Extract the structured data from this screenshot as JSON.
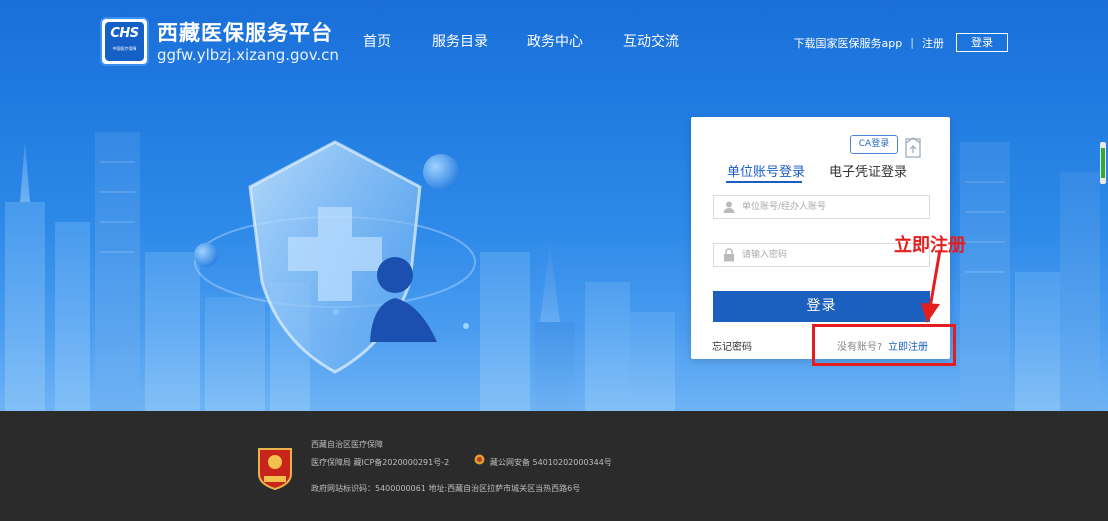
{
  "header": {
    "logo_text": "CHS",
    "logo_subtext": "中国医疗保障",
    "title": "西藏医保服务平台",
    "url": "ggfw.ylbzj.xizang.gov.cn",
    "nav": [
      "首页",
      "服务目录",
      "政务中心",
      "互动交流"
    ],
    "download_app": "下载国家医保服务app",
    "separator": "|",
    "register": "注册",
    "login": "登录"
  },
  "login_card": {
    "ca_login": "CA登录",
    "tabs": [
      "单位账号登录",
      "电子凭证登录"
    ],
    "account_placeholder": "单位账号/经办人账号",
    "password_placeholder": "请输入密码",
    "login_button": "登录",
    "forgot_password": "忘记密码",
    "no_account": "没有账号?",
    "register_now": "立即注册"
  },
  "annotation": {
    "label": "立即注册",
    "color": "#e41e1e"
  },
  "footer": {
    "org": "西藏自治区医疗保障",
    "icp": "医疗保障局 藏ICP备2020000291号-2",
    "police": "藏公网安备 54010202000344号",
    "site_info": "政府网站标识码：5400000061 地址:西藏自治区拉萨市城关区当热西路6号",
    "emblem_text": "党政机关"
  },
  "colors": {
    "primary": "#1b5fbf",
    "header_bg": "#1a6fd8",
    "footer_bg": "#2b2b2b",
    "annotation": "#e41e1e"
  }
}
